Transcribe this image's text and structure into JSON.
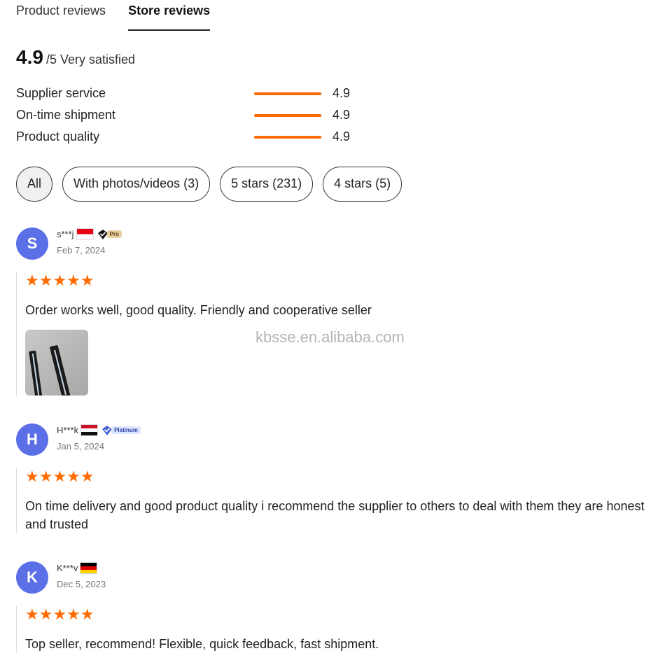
{
  "tabs": [
    {
      "label": "Product reviews",
      "active": false
    },
    {
      "label": "Store reviews",
      "active": true
    }
  ],
  "overall": {
    "score": "4.9",
    "out_of": "/5",
    "label": "Very satisfied"
  },
  "metrics": [
    {
      "label": "Supplier service",
      "value": "4.9",
      "fill_fraction": 0.98
    },
    {
      "label": "On-time shipment",
      "value": "4.9",
      "fill_fraction": 0.98
    },
    {
      "label": "Product quality",
      "value": "4.9",
      "fill_fraction": 0.98
    }
  ],
  "filters": [
    {
      "label": "All",
      "selected": true
    },
    {
      "label": "With photos/videos (3)",
      "selected": false
    },
    {
      "label": "5 stars (231)",
      "selected": false
    },
    {
      "label": "4 stars (5)",
      "selected": false
    }
  ],
  "reviews": [
    {
      "initial": "S",
      "user": "s***j",
      "country_flag": "flag-indonesia-icon",
      "badge": "Pro",
      "date": "Feb 7, 2024",
      "stars": "★★★★★",
      "rating": 5,
      "text": "Order works well, good quality. Friendly and cooperative seller",
      "has_photo": true
    },
    {
      "initial": "H",
      "user": "H***k",
      "country_flag": "flag-egypt-icon",
      "badge": "Platinum",
      "date": "Jan 5, 2024",
      "stars": "★★★★★",
      "rating": 5,
      "text": "On time delivery and good product quality i recommend the supplier to others to deal with them they are honest and trusted",
      "has_photo": false
    },
    {
      "initial": "K",
      "user": "K***v",
      "country_flag": "flag-germany-icon",
      "badge": "",
      "date": "Dec 5, 2023",
      "stars": "★★★★★",
      "rating": 5,
      "text": "Top seller, recommend! Flexible, quick feedback, fast shipment.",
      "has_photo": false
    }
  ],
  "watermark": "kbsse.en.alibaba.com",
  "colors": {
    "accent": "#ff6a00",
    "avatar": "#5b6fe6",
    "text": "#222222"
  }
}
